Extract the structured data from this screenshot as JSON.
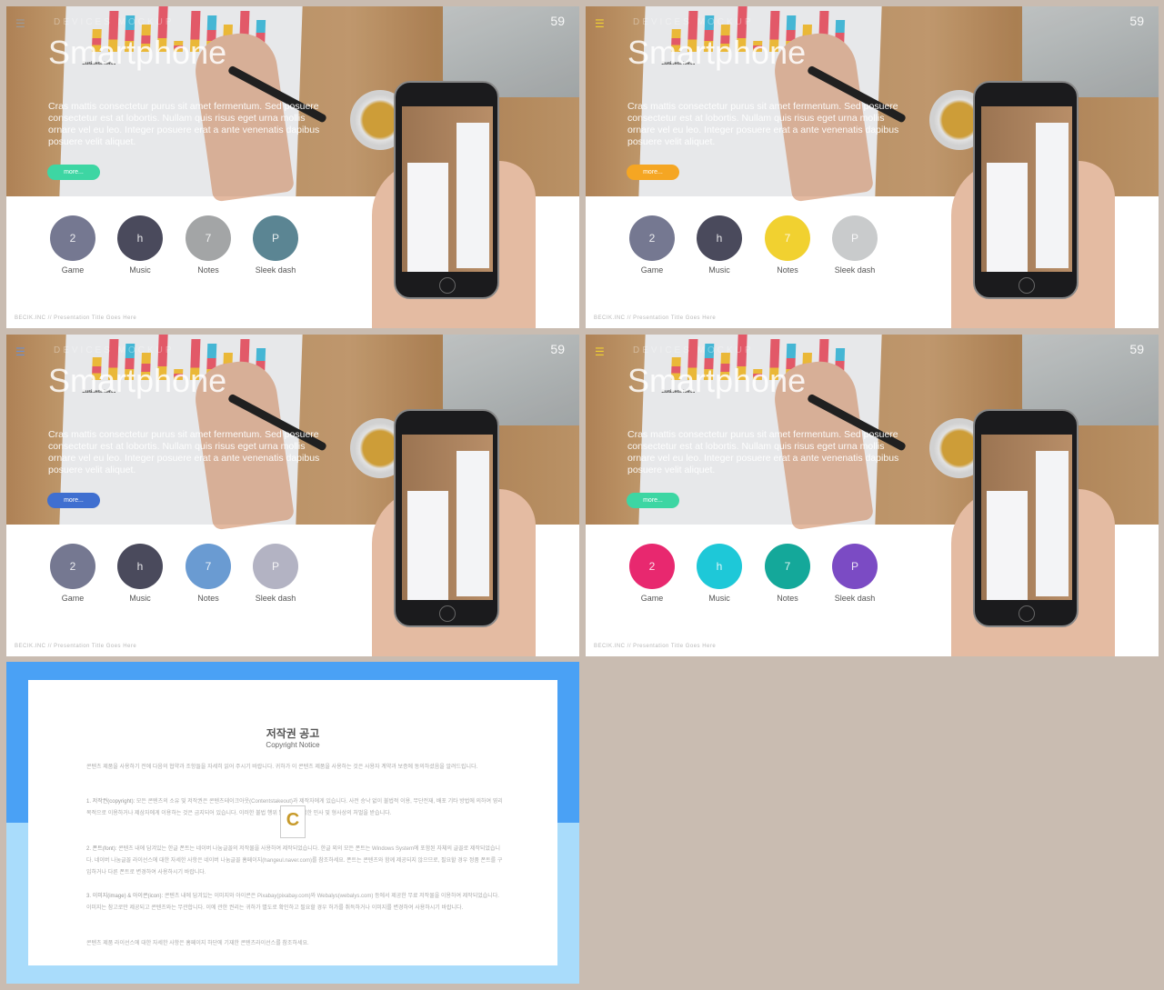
{
  "slide_template": {
    "kicker": "DEVICES MOCKUP",
    "title": "Smartphone",
    "page_number": "59",
    "body": "Cras mattis consectetur purus sit amet fermentum. Sed posuere consectetur est at lobortis. Nullam quis risus eget urna mollis ornare vel eu leo. Integer posuere erat a ante venenatis dapibus posuere velit aliquet.",
    "button_label": "more...",
    "chart_caption": "Business items",
    "footer": "BECIK.INC  //  Presentation  Title  Goes  Here",
    "items": [
      {
        "glyph": "2",
        "label": "Game"
      },
      {
        "glyph": "h",
        "label": "Music"
      },
      {
        "glyph": "7",
        "label": "Notes"
      },
      {
        "glyph": "P",
        "label": "Sleek dash"
      }
    ]
  },
  "slides": [
    {
      "menu_color": "#9a9a9a",
      "button_color": "#3dd6a3",
      "circle_colors": [
        "#757891",
        "#4a4a5c",
        "#a3a5a6",
        "#5b8593"
      ]
    },
    {
      "menu_color": "#f1d130",
      "button_color": "#f5a623",
      "circle_colors": [
        "#757891",
        "#4a4a5c",
        "#f1d130",
        "#c9cbcc"
      ]
    },
    {
      "menu_color": "#6a8fd0",
      "button_color": "#3f6fd0",
      "circle_colors": [
        "#757891",
        "#4a4a5c",
        "#6a9bd2",
        "#b3b3c3"
      ]
    },
    {
      "menu_color": "#f1d130",
      "button_color": "#3dd6a3",
      "circle_colors": [
        "#e8286f",
        "#1ec8d8",
        "#14a89a",
        "#7b4bc4"
      ]
    }
  ],
  "notice": {
    "title": "저작권 공고",
    "subtitle": "Copyright Notice",
    "intro": "콘텐츠 제품을 사용하기 전에 다음의 협약과 조항들을 자세히 읽어 주시기 바랍니다. 귀하가 이 콘텐츠 제품을 사용하는 것은 사용자 계약과 보증에 동의하셨음을 알려드립니다.",
    "s1_head": "1. 저작권(copyright):",
    "s1": "모든 콘텐츠의 소유 및 저작권은 콘텐츠테이크아웃(Contentstakeout)과 제작자에게 있습니다. 사전 승낙 없이 불법적 이용, 무단전재, 배포 기타 방법에 의하여 영리 목적으로 이용하거나 제삼자에게 이용하는 것은 금지되어 있습니다. 이러한 불법 행위 발견 시 준엄한 민사 및 형사상의 처벌을 받습니다.",
    "s2_head": "2. 폰트(font):",
    "s2": "콘텐츠 내에 담겨있는 한글 폰트는 네이버 나눔글꼴의 저작물을 사용하여 제작되었습니다. 한글 외의 모든 폰트는 Windows System에 포함된 자체의 글꼴로 제작되었습니다. 네이버 나눔글꼴 라이선스에 대한 자세한 사항은 네이버 나눔글꼴 홈페이지(hangeul.naver.com)를 참조하세요. 폰트는 콘텐츠와 함께 제공되지 않으므로, 필요할 경우 정품 폰트를 구입하거나 다른 폰트로 변경하여 사용하시기 바랍니다.",
    "s3_head": "3. 이미지(image) & 아이콘(icon):",
    "s3": "콘텐츠 내에 담겨있는 이미지와 아이콘은 Pixabay(pixabay.com)와 Webalys(webalys.com) 등에서 제공한 무료 저작물을 이용하여 제작되었습니다. 이미지는 참고로만 제공되고 콘텐츠와는 무관합니다. 이에 관한 권리는 귀하가 별도로 확인하고 필요할 경우 허가를 취득하거나 이미지를 변경하여 사용하시기 바랍니다.",
    "outro": "콘텐츠 제품 라이선스에 대한 자세한 사항은 홈페이지 하단에 기재한 콘텐츠라이선스를 참조하세요."
  }
}
